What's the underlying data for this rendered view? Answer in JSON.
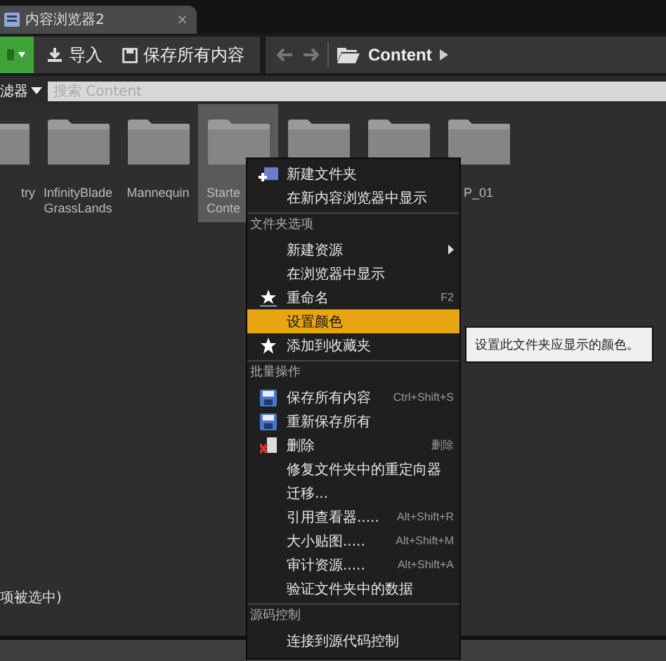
{
  "tab": {
    "title": "内容浏览器2",
    "close": "×"
  },
  "toolbar": {
    "import": "导入",
    "save_all": "保存所有内容",
    "path": "Content"
  },
  "filter": {
    "label": "滤器",
    "search": {
      "placeholder": "搜索 Content"
    }
  },
  "folders": [
    {
      "lines": [
        "try"
      ],
      "selected": false
    },
    {
      "lines": [
        "InfinityBlade",
        "GrassLands"
      ],
      "selected": false
    },
    {
      "lines": [
        "Mannequin"
      ],
      "selected": false
    },
    {
      "lines": [
        "Starte",
        "Conte"
      ],
      "selected": true
    },
    {
      "selected": false
    },
    {
      "selected": false
    },
    {
      "lines": [
        "P_01"
      ],
      "selected": false
    }
  ],
  "menu": [
    {
      "kind": "item",
      "label": "新建文件夹",
      "submenu": false,
      "selected": false
    },
    {
      "kind": "item",
      "label": "在新内容浏览器中显示",
      "submenu": false,
      "selected": false
    },
    {
      "kind": "header",
      "label": "文件夹选项"
    },
    {
      "kind": "item",
      "label": "新建资源",
      "submenu": true,
      "selected": false
    },
    {
      "kind": "item",
      "label": "在浏览器中显示",
      "submenu": false,
      "selected": false
    },
    {
      "kind": "item",
      "label": "重命名",
      "shortcut": "F2",
      "submenu": false,
      "selected": false
    },
    {
      "kind": "item",
      "label": "设置颜色",
      "submenu": false,
      "selected": true
    },
    {
      "kind": "item",
      "label": "添加到收藏夹",
      "submenu": false,
      "selected": false
    },
    {
      "kind": "header",
      "label": "批量操作"
    },
    {
      "kind": "item",
      "label": "保存所有内容",
      "shortcut": "Ctrl+Shift+S",
      "submenu": false,
      "selected": false
    },
    {
      "kind": "item",
      "label": "重新保存所有",
      "submenu": false,
      "selected": false
    },
    {
      "kind": "item",
      "label": "删除",
      "shortcut": "删除",
      "submenu": false,
      "selected": false
    },
    {
      "kind": "item",
      "label": "修复文件夹中的重定向器",
      "submenu": false,
      "selected": false
    },
    {
      "kind": "item",
      "label": "迁移...",
      "submenu": false,
      "selected": false
    },
    {
      "kind": "item",
      "label": "引用查看器.....",
      "shortcut": "Alt+Shift+R",
      "submenu": false,
      "selected": false
    },
    {
      "kind": "item",
      "label": "大小贴图.....",
      "shortcut": "Alt+Shift+M",
      "submenu": false,
      "selected": false
    },
    {
      "kind": "item",
      "label": "审计资源.....",
      "shortcut": "Alt+Shift+A",
      "submenu": false,
      "selected": false
    },
    {
      "kind": "item",
      "label": "验证文件夹中的数据",
      "submenu": false,
      "selected": false
    },
    {
      "kind": "header",
      "label": "源码控制"
    },
    {
      "kind": "item",
      "label": "连接到源代码控制",
      "submenu": false,
      "selected": false
    }
  ],
  "tooltip": "设置此文件夹应显示的颜色。",
  "status": "项被选中)"
}
